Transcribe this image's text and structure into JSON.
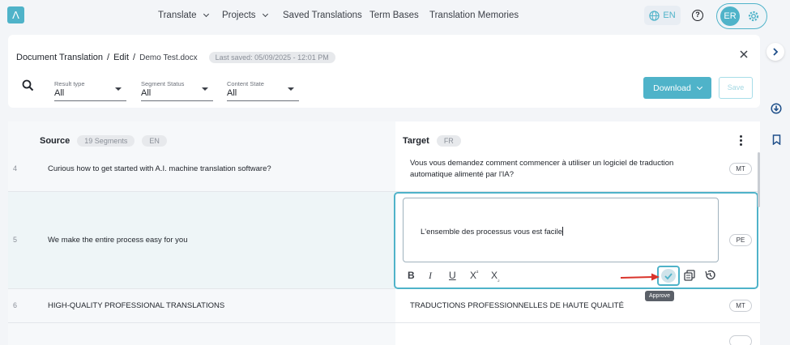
{
  "app": {
    "logo_text": "Λ",
    "nav": {
      "translate": "Translate",
      "projects": "Projects",
      "saved_translations": "Saved Translations",
      "term_bases": "Term Bases",
      "translation_memories": "Translation Memories"
    },
    "language": "EN",
    "user_initials": "ER",
    "accent_color": "#4fb3c9"
  },
  "header": {
    "breadcrumb": {
      "section": "Document Translation",
      "action": "Edit",
      "file": "Demo Test.docx"
    },
    "last_saved": "Last saved: 05/09/2025 - 12:01 PM",
    "filters": [
      {
        "label": "Result type",
        "value": "All"
      },
      {
        "label": "Segment Status",
        "value": "All"
      },
      {
        "label": "Content State",
        "value": "All"
      }
    ],
    "download_label": "Download",
    "save_label": "Save"
  },
  "table": {
    "source_label": "Source",
    "segments_count": "19 Segments",
    "source_lang": "EN",
    "target_label": "Target",
    "target_lang": "FR",
    "rows": [
      {
        "num": "4",
        "source": "Curious how to get started with A.I. machine translation software?",
        "target": "Vous vous demandez comment commencer à utiliser un logiciel de traduction automatique alimenté par l'IA?",
        "badge": "MT"
      },
      {
        "num": "5",
        "source": "We make the entire process easy for you",
        "target": "L'ensemble des processus vous est facile",
        "badge": "PE"
      },
      {
        "num": "6",
        "source": "HIGH-QUALITY PROFESSIONAL TRANSLATIONS",
        "target": "TRADUCTIONS PROFESSIONNELLES DE HAUTE QUALITÉ",
        "badge": "MT"
      }
    ],
    "tooltip": "Approve"
  }
}
